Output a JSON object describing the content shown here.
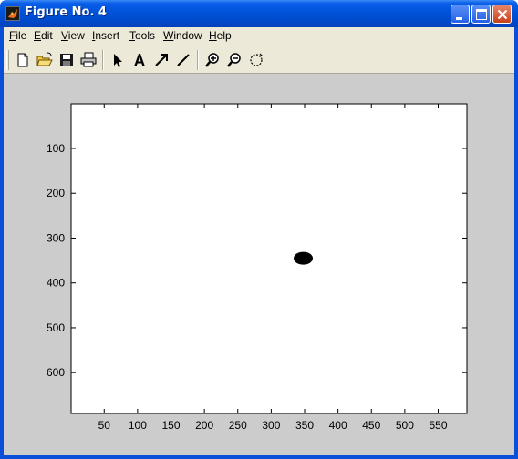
{
  "window": {
    "title": "Figure No. 4",
    "app_icon": "matlab-logo-icon",
    "controls": [
      "minimize-icon",
      "maximize-icon",
      "close-icon"
    ]
  },
  "menubar": {
    "items": [
      {
        "label_pre": "",
        "mnemonic": "F",
        "label_post": "ile"
      },
      {
        "label_pre": "",
        "mnemonic": "E",
        "label_post": "dit"
      },
      {
        "label_pre": "",
        "mnemonic": "V",
        "label_post": "iew"
      },
      {
        "label_pre": "",
        "mnemonic": "I",
        "label_post": "nsert"
      },
      {
        "label_pre": "",
        "mnemonic": "T",
        "label_post": "ools"
      },
      {
        "label_pre": "",
        "mnemonic": "W",
        "label_post": "indow"
      },
      {
        "label_pre": "",
        "mnemonic": "H",
        "label_post": "elp"
      }
    ]
  },
  "toolbar": {
    "tools": [
      "new-file-icon",
      "open-folder-icon",
      "save-icon",
      "print-icon",
      "select-arrow-icon",
      "insert-text-icon",
      "insert-arrow-icon",
      "insert-line-icon",
      "zoom-in-icon",
      "zoom-out-icon",
      "rotate-icon"
    ]
  },
  "plot": {
    "x_ticks": [
      "50",
      "100",
      "150",
      "200",
      "250",
      "300",
      "350",
      "400",
      "450",
      "500",
      "550"
    ],
    "y_ticks": [
      "100",
      "200",
      "300",
      "400",
      "500",
      "600"
    ],
    "background": "#ffffff",
    "blob_color": "#000000",
    "blob_center": {
      "x": 348,
      "y": 345
    }
  }
}
